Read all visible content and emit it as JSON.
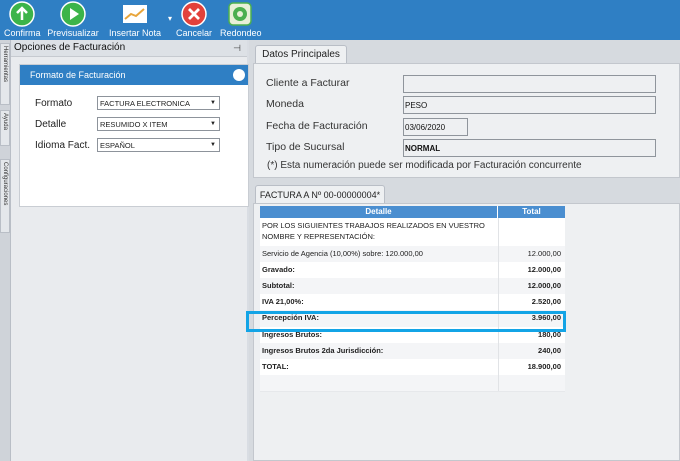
{
  "toolbar": {
    "buttons": [
      {
        "label": "Confirma",
        "icon": "confirm-icon",
        "color": "#3cb44a"
      },
      {
        "label": "Previsualizar",
        "icon": "play-icon",
        "color": "#3cb44a"
      },
      {
        "label": "Insertar Nota",
        "icon": "note-icon"
      },
      {
        "label": "Cancelar",
        "icon": "cancel-icon",
        "color": "#e2413b"
      },
      {
        "label": "Redondeo",
        "icon": "round-icon",
        "color": "#4caf50"
      }
    ]
  },
  "side_tabs": [
    "Herramientas",
    "Ayuda",
    "Configuraciones"
  ],
  "left_panel": {
    "title": "Opciones de Facturación",
    "section_title": "Formato de Facturación",
    "fields": [
      {
        "label": "Formato",
        "value": "FACTURA ELECTRONICA"
      },
      {
        "label": "Detalle",
        "value": "RESUMIDO X ITEM"
      },
      {
        "label": "Idioma Fact.",
        "value": "ESPAÑOL"
      }
    ]
  },
  "datos": {
    "tab": "Datos Principales",
    "fields": [
      {
        "label": "Cliente a Facturar",
        "value": ""
      },
      {
        "label": "Moneda",
        "value": "PESO"
      },
      {
        "label": "Fecha de Facturación",
        "value": "03/06/2020"
      },
      {
        "label": "Tipo de Sucursal",
        "value": "NORMAL"
      }
    ],
    "note": "(*) Esta numeración puede ser modificada por Facturación concurrente"
  },
  "factura": {
    "tab": "FACTURA A Nº 00-00000004*",
    "columns": [
      "Detalle",
      "Total"
    ],
    "rows": [
      {
        "detalle": "POR LOS SIGUIENTES TRABAJOS REALIZADOS EN VUESTRO NOMBRE Y REPRESENTACIÓN:",
        "total": "",
        "bold": false
      },
      {
        "detalle": "Servicio de Agencia (10,00%) sobre: 120.000,00",
        "total": "12.000,00",
        "bold": false
      },
      {
        "detalle": "Gravado:",
        "total": "12.000,00",
        "bold": true
      },
      {
        "detalle": "Subtotal:",
        "total": "12.000,00",
        "bold": true
      },
      {
        "detalle": "IVA 21,00%:",
        "total": "2.520,00",
        "bold": true
      },
      {
        "detalle": "Percepción IVA:",
        "total": "3.960,00",
        "bold": true
      },
      {
        "detalle": "Ingresos Brutos:",
        "total": "180,00",
        "bold": true
      },
      {
        "detalle": "Ingresos Brutos 2da Jurisdicción:",
        "total": "240,00",
        "bold": true
      },
      {
        "detalle": "TOTAL:",
        "total": "18.900,00",
        "bold": true
      },
      {
        "detalle": "",
        "total": "",
        "bold": false
      }
    ]
  }
}
